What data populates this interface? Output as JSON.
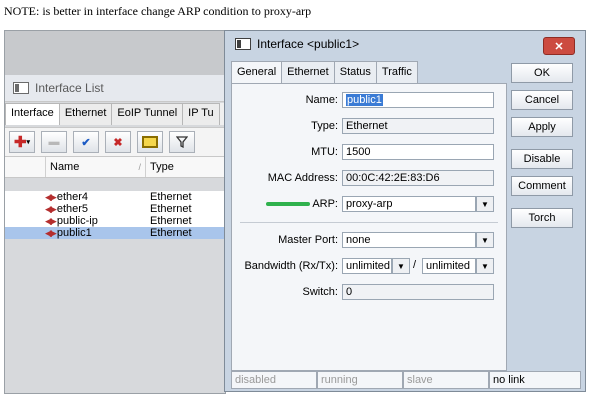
{
  "note": "NOTE: is better in interface change ARP condition to proxy-arp",
  "interface_list": {
    "title": "Interface List",
    "tabs": [
      "Interface",
      "Ethernet",
      "EoIP Tunnel",
      "IP Tu"
    ],
    "columns": {
      "name": "Name",
      "type": "Type"
    },
    "rows": [
      {
        "name": "ether4",
        "type": "Ethernet"
      },
      {
        "name": "ether5",
        "type": "Ethernet"
      },
      {
        "name": "public-ip",
        "type": "Ethernet"
      },
      {
        "name": "public1",
        "type": "Ethernet"
      }
    ]
  },
  "dialog": {
    "title": "Interface <public1>",
    "tabs": [
      "General",
      "Ethernet",
      "Status",
      "Traffic"
    ],
    "fields": {
      "name_label": "Name:",
      "name_value": "public1",
      "type_label": "Type:",
      "type_value": "Ethernet",
      "mtu_label": "MTU:",
      "mtu_value": "1500",
      "mac_label": "MAC Address:",
      "mac_value": "00:0C:42:2E:83:D6",
      "arp_label": "ARP:",
      "arp_value": "proxy-arp",
      "master_label": "Master Port:",
      "master_value": "none",
      "bandwidth_label": "Bandwidth (Rx/Tx):",
      "bandwidth_rx": "unlimited",
      "bandwidth_sep": "/",
      "bandwidth_tx": "unlimited",
      "switch_label": "Switch:",
      "switch_value": "0"
    },
    "buttons": [
      "OK",
      "Cancel",
      "Apply",
      "Disable",
      "Comment",
      "Torch"
    ],
    "status": {
      "disabled": "disabled",
      "running": "running",
      "slave": "slave",
      "link": "no link"
    }
  },
  "colors": {
    "accent_green": "#2fb14d",
    "selection": "#a9c5eb",
    "close": "#cc4b40"
  }
}
